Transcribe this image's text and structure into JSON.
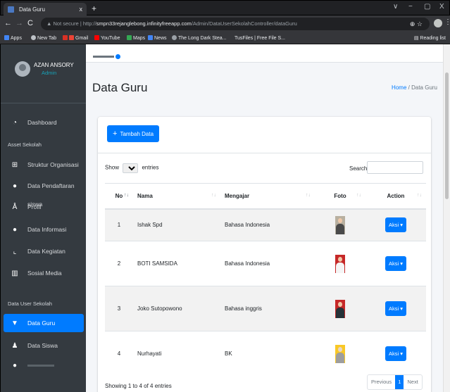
{
  "browser": {
    "tab_title": "Data Guru",
    "tab_close": "x",
    "new_tab": "+",
    "url_prefix": "▲ Not secure | http://",
    "url_host": "smpn33rejanglebong.infinityfreeapp.com",
    "url_path": "/Admin/DataUserSekolahController/dataGuru",
    "omni_icons": "⊕ ☆",
    "bookmarks": [
      "Apps",
      "New Tab",
      "Gmail",
      "YouTube",
      "Maps",
      "News",
      "The Long Dark Stea...",
      "TusFiles | Free File S..."
    ],
    "reading_list": "Reading list",
    "window_controls": [
      "∨",
      "−",
      "▢",
      "X"
    ]
  },
  "sidebar": {
    "user_name": "AZAN ANSORY",
    "user_role": "Admin",
    "items": [
      {
        "label": "Dashboard",
        "icon": "dashboard-icon"
      },
      {
        "label": "Struktur Organisasi",
        "icon": "sitemap-icon"
      },
      {
        "label": "Data Pendaftaran siswa",
        "icon": "users-icon"
      },
      {
        "label": "Profil",
        "icon": "school-icon"
      },
      {
        "label": "Data Informasi",
        "icon": "info-icon"
      },
      {
        "label": "Data Kegiatan",
        "icon": "chart-icon"
      },
      {
        "label": "Sosial Media",
        "icon": "bar-chart-icon"
      },
      {
        "label": "Data Guru",
        "icon": "teacher-icon"
      },
      {
        "label": "Data Siswa",
        "icon": "student-icon"
      }
    ],
    "headers": [
      "Asset Sekolah",
      "Data User Sekolah"
    ]
  },
  "main": {
    "title": "Data Guru",
    "breadcrumb_home": "Home",
    "breadcrumb_sep": "/",
    "breadcrumb_current": "Data Guru",
    "add_button": "Tambah Data",
    "show_label": "Show",
    "entries_value": "10",
    "entries_label": "entries",
    "search_label": "Search:",
    "columns": [
      "No",
      "Nama",
      "Mengajar",
      "Foto",
      "Action"
    ],
    "rows": [
      {
        "no": "1",
        "nama": "Ishak Spd",
        "mengajar": "Bahasa Indonesia",
        "action": "Aksi"
      },
      {
        "no": "2",
        "nama": "BOTI SAMSIDA",
        "mengajar": "Bahasa Indonesia",
        "action": "Aksi"
      },
      {
        "no": "3",
        "nama": "Joko Sutopowono",
        "mengajar": "Bahasa inggris",
        "action": "Aksi"
      },
      {
        "no": "4",
        "nama": "Nurhayati",
        "mengajar": "BK",
        "action": "Aksi"
      }
    ],
    "info": "Showing 1 to 4 of 4 entries",
    "pager": {
      "prev": "Previous",
      "current": "1",
      "next": "Next"
    }
  },
  "colors": {
    "primary": "#007bff",
    "sidebar": "#343a40",
    "content_bg": "#f4f6f9"
  }
}
